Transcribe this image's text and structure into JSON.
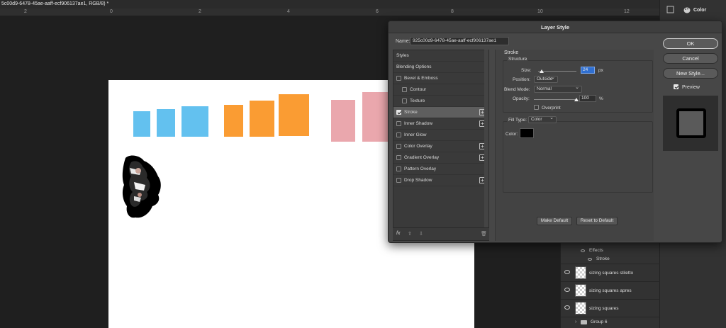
{
  "window": {
    "title": "5c00d9-6478-45ae-aaff-ecf906137ae1, RGB/8) *"
  },
  "ruler_ticks": [
    "2",
    "0",
    "2",
    "4",
    "6",
    "8",
    "10",
    "12"
  ],
  "colors": {
    "blue": "#63c1ef",
    "orange": "#fa9c33",
    "pink": "#eaa7ad",
    "dialog_bg": "#474747"
  },
  "right_panel": {
    "color_label": "Color",
    "color_icon": "palette-icon"
  },
  "layers": {
    "effects_label": "Effects",
    "stroke_effect_label": "Stroke",
    "rows": [
      {
        "name": "sizing squares stiletto"
      },
      {
        "name": "sizing squares apres"
      },
      {
        "name": "sizing squares"
      }
    ],
    "group_name": "Group 6"
  },
  "dialog": {
    "title": "Layer Style",
    "name_label": "Name:",
    "name_value": "925c00d9-6478-45ae-aaff-ecf906137ae1",
    "styles": [
      {
        "label": "Styles",
        "indent": 0,
        "checkbox": false,
        "checked": false,
        "plus": false,
        "selected": false
      },
      {
        "label": "Blending Options",
        "indent": 0,
        "checkbox": false,
        "checked": false,
        "plus": false,
        "selected": false
      },
      {
        "label": "Bevel & Emboss",
        "indent": 0,
        "checkbox": true,
        "checked": false,
        "plus": false,
        "selected": false
      },
      {
        "label": "Contour",
        "indent": 1,
        "checkbox": true,
        "checked": false,
        "plus": false,
        "selected": false
      },
      {
        "label": "Texture",
        "indent": 1,
        "checkbox": true,
        "checked": false,
        "plus": false,
        "selected": false
      },
      {
        "label": "Stroke",
        "indent": 0,
        "checkbox": true,
        "checked": true,
        "plus": true,
        "selected": true
      },
      {
        "label": "Inner Shadow",
        "indent": 0,
        "checkbox": true,
        "checked": false,
        "plus": true,
        "selected": false
      },
      {
        "label": "Inner Glow",
        "indent": 0,
        "checkbox": true,
        "checked": false,
        "plus": false,
        "selected": false
      },
      {
        "label": "Color Overlay",
        "indent": 0,
        "checkbox": true,
        "checked": false,
        "plus": true,
        "selected": false
      },
      {
        "label": "Gradient Overlay",
        "indent": 0,
        "checkbox": true,
        "checked": false,
        "plus": true,
        "selected": false
      },
      {
        "label": "Pattern Overlay",
        "indent": 0,
        "checkbox": true,
        "checked": false,
        "plus": false,
        "selected": false
      },
      {
        "label": "Drop Shadow",
        "indent": 0,
        "checkbox": true,
        "checked": false,
        "plus": true,
        "selected": false
      }
    ],
    "footer": {
      "fx_label": "fx",
      "up_icon": "move-up-icon",
      "down_icon": "move-down-icon",
      "trash_icon": "trash-icon"
    },
    "stroke": {
      "header": "Stroke",
      "structure_label": "Structure",
      "size_label": "Size:",
      "size_value": "24",
      "size_unit": "px",
      "size_fraction": 0.1,
      "position_label": "Position:",
      "position_value": "Outside",
      "blend_label": "Blend Mode:",
      "blend_value": "Normal",
      "opacity_label": "Opacity:",
      "opacity_value": "100",
      "opacity_unit": "%",
      "opacity_fraction": 1.0,
      "overprint_label": "Overprint",
      "fill_type_label": "Fill Type:",
      "fill_type_value": "Color",
      "color_label": "Color:",
      "color_value": "#000000",
      "make_default": "Make Default",
      "reset_default": "Reset to Default"
    },
    "buttons": {
      "ok": "OK",
      "cancel": "Cancel",
      "new_style": "New Style..."
    },
    "preview_label": "Preview",
    "preview_checked": true
  }
}
